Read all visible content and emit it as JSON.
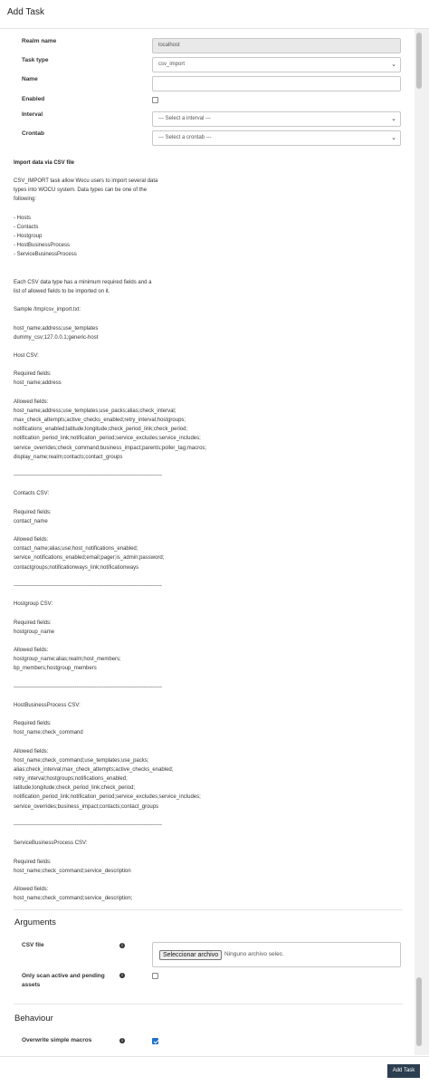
{
  "modal": {
    "title": "Add Task",
    "submit_label": "Add Task"
  },
  "form": {
    "realm_label": "Realm name",
    "realm_value": "localhost",
    "task_type_label": "Task type",
    "task_type_value": "csv_import",
    "name_label": "Name",
    "name_value": "",
    "enabled_label": "Enabled",
    "enabled_checked": false,
    "interval_label": "Interval",
    "interval_value": "--- Select a interval ---",
    "crontab_label": "Crontab",
    "crontab_value": "--- Select a crontab ---"
  },
  "doc": {
    "title": "Import data via CSV file",
    "body": "CSV_IMPORT task allow Wocu users to import several data\ntypes into WOCU system. Data types can be one of the\nfollowing:\n\n- Hosts\n- Contacts\n- Hostgroup\n- HostBusinessProcess\n- ServiceBusinessProcess\n\n\nEach CSV data type has a minimum required fields and a\nlist of allowed fields to be imported on it.\n\nSample /tmp/csv_import.txt:\n\nhost_name;address;use_templates\ndummy_csv;127.0.0.1;generic-host\n\nHost CSV:\n\nRequired fields:\nhost_name;address\n\nAllowed fields:\nhost_name;address;use_templates;use_packs;alias;check_interval;\nmax_check_attempts;active_checks_enabled;retry_interval;hostgroups;\nnotifications_enabled;latitude;longitude;check_period_link;check_period;\nnotification_period_link;notification_period;service_excludes;service_includes;\nservice_overrides;check_command;business_impact;parents;poller_tag;macros;\ndisplay_name;realm;contacts;contact_groups\n\n----------------------------------------------------------------------------------\n\nContacts CSV:\n\nRequired fields:\ncontact_name\n\nAllowed fields:\ncontact_name;alias;use;host_notifications_enabled;\nservice_notifications_enabled;email;pager;is_admin;password;\ncontactgroups;notificationways_link;notificationways\n\n----------------------------------------------------------------------------------\n\nHostgroup CSV:\n\nRequired fields:\nhostgroup_name\n\nAllowed fields:\nhostgroup_name;alias;realm;host_members;\nbp_members;hostgroup_members\n\n----------------------------------------------------------------------------------\n\nHostBusinessProcess CSV:\n\nRequired fields:\nhost_name;check_command\n\nAllowed fields:\nhost_name;check_command;use_templates;use_packs;\nalias;check_interval;max_check_attempts;active_checks_enabled;\nretry_interval;hostgroups;notifications_enabled;\nlatitude;longitude;check_period_link;check_period;\nnotification_period_link;notification_period;service_excludes;service_includes;\nservice_overrides;business_impact;contacts;contact_groups\n\n----------------------------------------------------------------------------------\n\nServiceBusinessProcess CSV:\n\nRequired fields:\nhost_name;check_command;service_description\n\nAllowed fields:\nhost_name;check_command;service_description;"
  },
  "arguments": {
    "section_title": "Arguments",
    "csv_label": "CSV file",
    "file_button": "Seleccionar archivo",
    "file_status": "Ninguno archivo selec.",
    "scan_label": "Only scan active and pending assets",
    "scan_checked": false
  },
  "behaviour": {
    "section_title": "Behaviour",
    "overwrite_label": "Overwrite simple macros",
    "overwrite_checked": true
  },
  "icons": {
    "info": "info-icon",
    "chevron": "chevron-down-icon"
  }
}
